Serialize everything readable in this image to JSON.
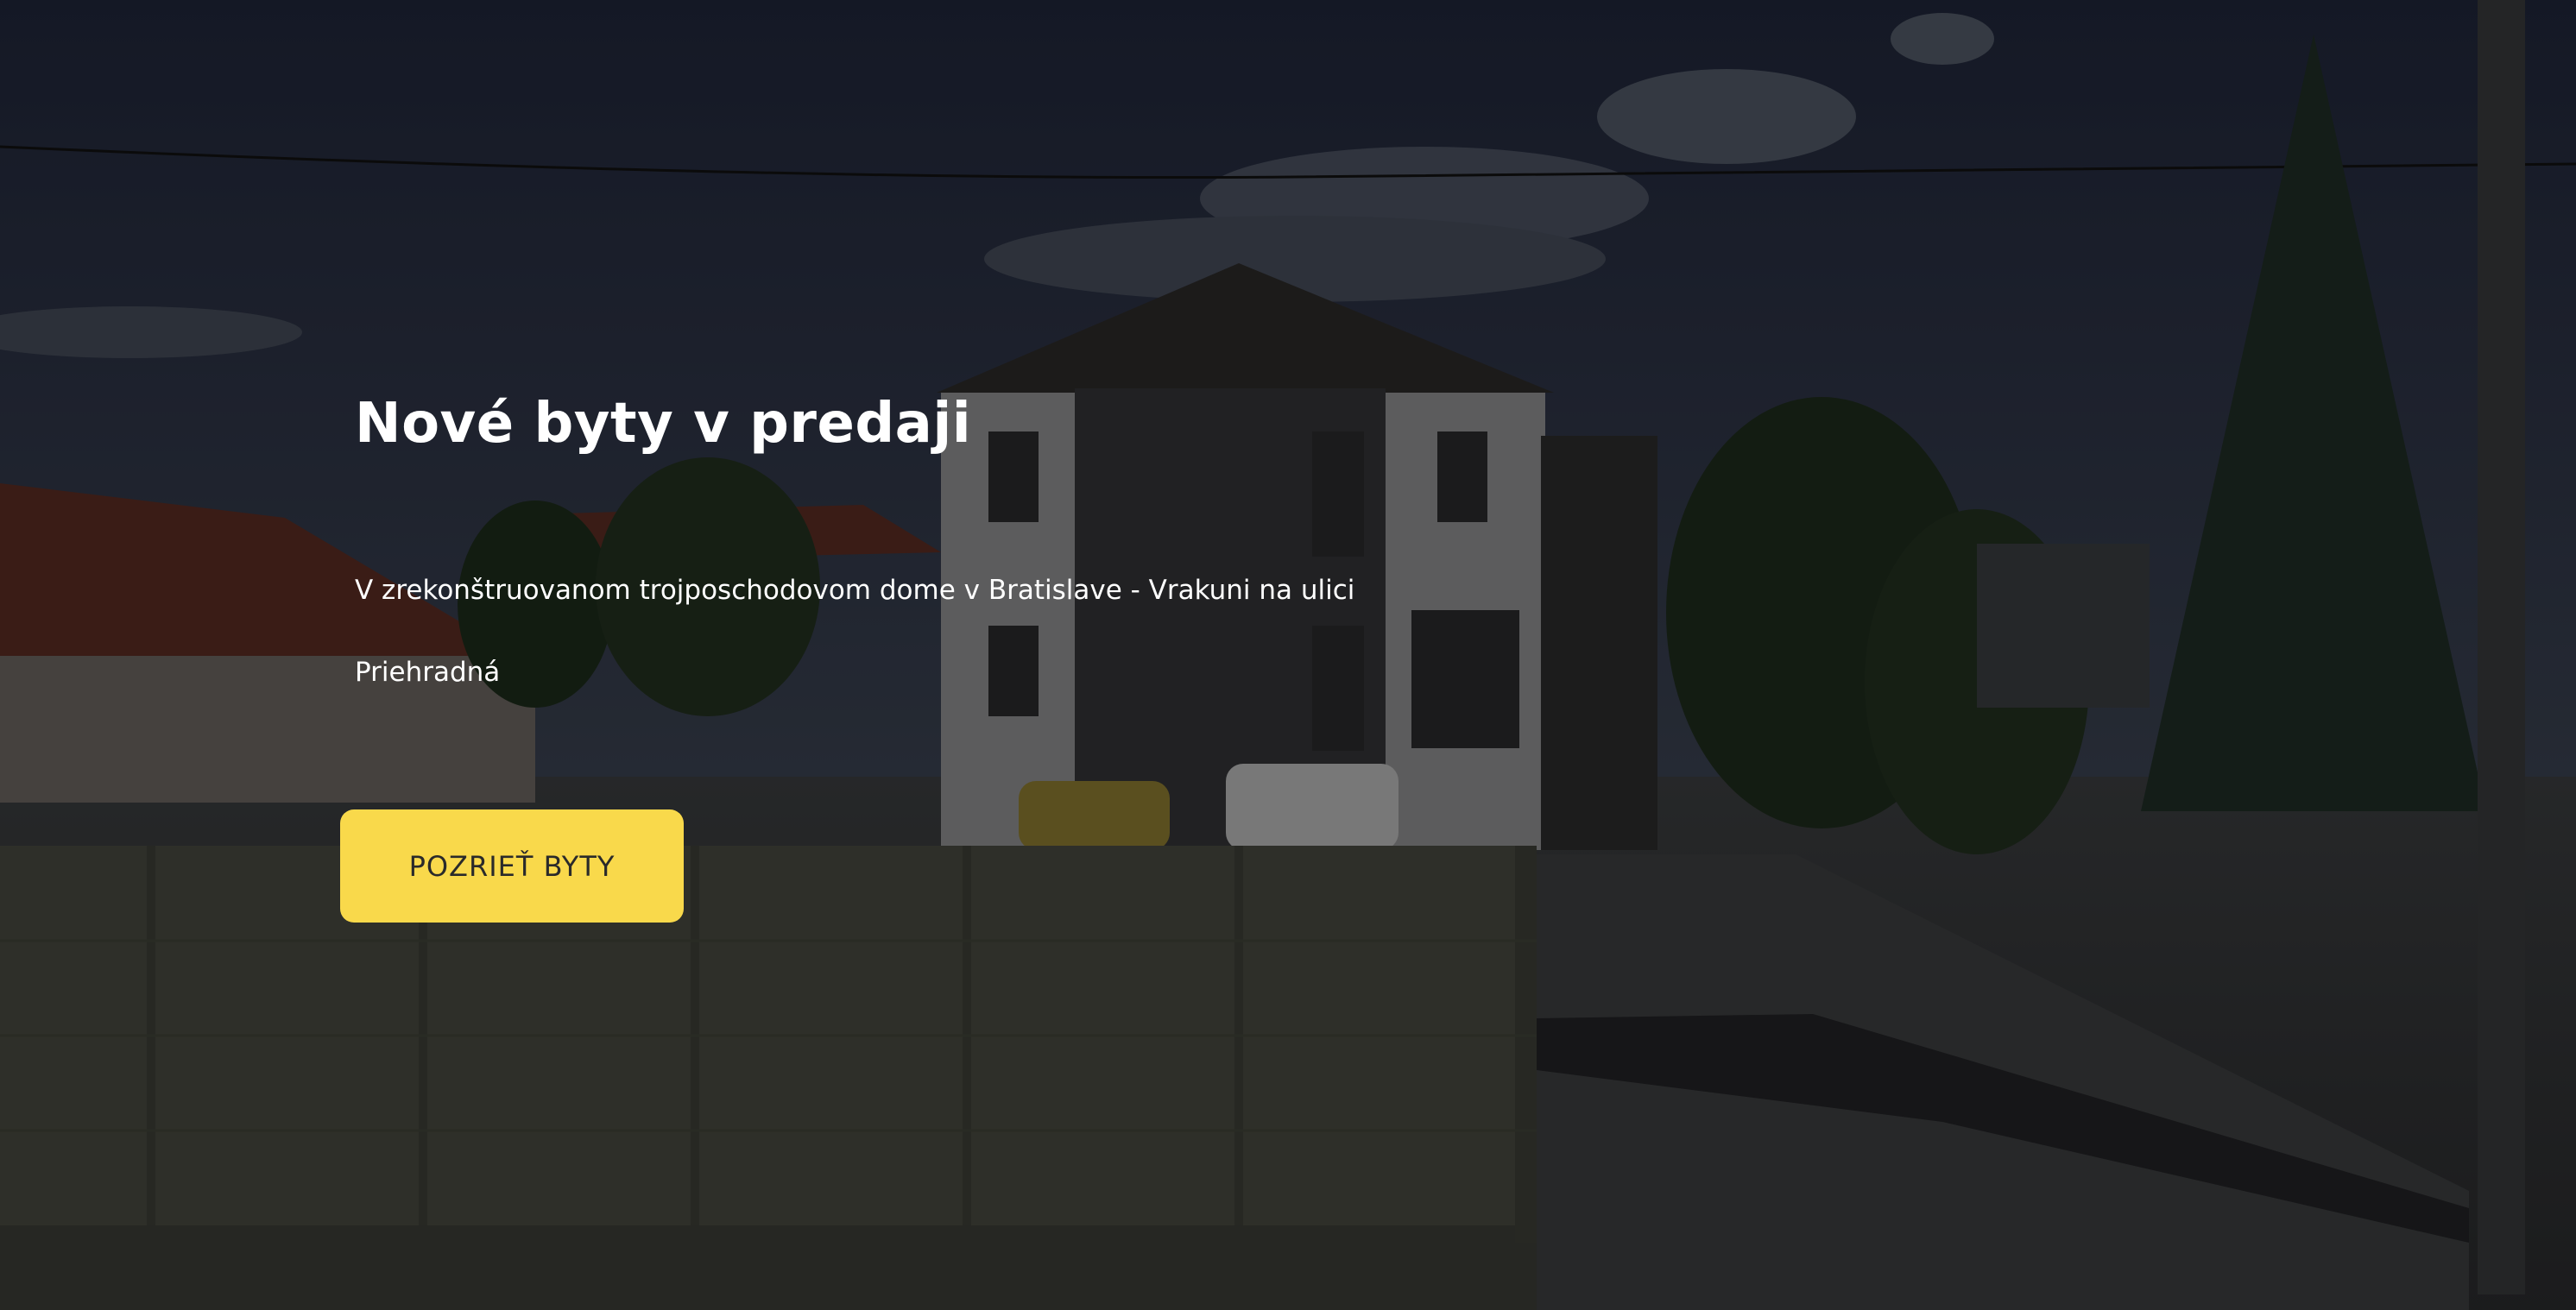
{
  "hero": {
    "title": "Nové byty v predaji",
    "description_line1": "V zrekonštruovanom trojposchodovom dome v Bratislave - Vrakuni na ulici",
    "description_line2": "Priehradná",
    "cta_label": "POZRIEŤ BYTY"
  },
  "colors": {
    "accent": "#f9d94b",
    "overlay": "#1d1f24",
    "text": "#ffffff",
    "button_text": "#2a2a2a"
  }
}
